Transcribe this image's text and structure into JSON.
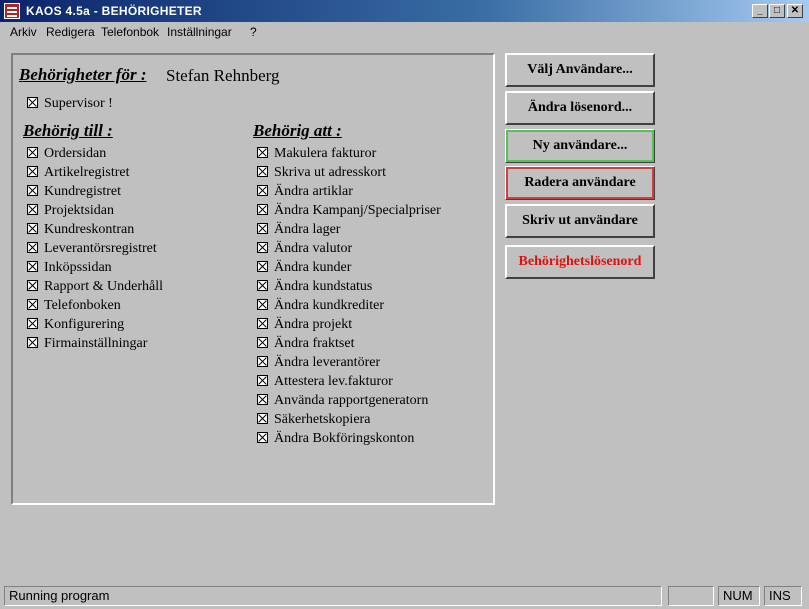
{
  "window": {
    "title": "KAOS 4.5a - BEHÖRIGHETER",
    "controls": {
      "minimize": "_",
      "restore": "□",
      "close": "✕"
    }
  },
  "menu": [
    {
      "label": "Arkiv"
    },
    {
      "label": "Redigera"
    },
    {
      "label": "Telefonbok"
    },
    {
      "label": "Inställningar"
    },
    {
      "label": "?"
    }
  ],
  "panel": {
    "header_label": "Behörigheter för :",
    "user_name": "Stefan Rehnberg",
    "supervisor": {
      "label": "Supervisor !",
      "checked": true
    },
    "behorig_till": {
      "heading": "Behörig till :",
      "items": [
        {
          "label": "Ordersidan",
          "checked": true
        },
        {
          "label": "Artikelregistret",
          "checked": true
        },
        {
          "label": "Kundregistret",
          "checked": true
        },
        {
          "label": "Projektsidan",
          "checked": true
        },
        {
          "label": "Kundreskontran",
          "checked": true
        },
        {
          "label": "Leverantörsregistret",
          "checked": true
        },
        {
          "label": "Inköpssidan",
          "checked": true
        },
        {
          "label": "Rapport & Underhåll",
          "checked": true
        },
        {
          "label": "Telefonboken",
          "checked": true
        },
        {
          "label": "Konfigurering",
          "checked": true
        },
        {
          "label": "Firmainställningar",
          "checked": true
        }
      ]
    },
    "behorig_att": {
      "heading": "Behörig att :",
      "items": [
        {
          "label": "Makulera fakturor",
          "checked": true
        },
        {
          "label": "Skriva ut adresskort",
          "checked": true
        },
        {
          "label": "Ändra artiklar",
          "checked": true
        },
        {
          "label": "Ändra Kampanj/Specialpriser",
          "checked": true
        },
        {
          "label": "Ändra lager",
          "checked": true
        },
        {
          "label": "Ändra valutor",
          "checked": true
        },
        {
          "label": "Ändra kunder",
          "checked": true
        },
        {
          "label": "Ändra kundstatus",
          "checked": true
        },
        {
          "label": "Ändra kundkrediter",
          "checked": true
        },
        {
          "label": "Ändra projekt",
          "checked": true
        },
        {
          "label": "Ändra fraktset",
          "checked": true
        },
        {
          "label": "Ändra leverantörer",
          "checked": true
        },
        {
          "label": "Attestera lev.fakturor",
          "checked": true
        },
        {
          "label": "Använda rapportgeneratorn",
          "checked": true
        },
        {
          "label": "Säkerhetskopiera",
          "checked": true
        },
        {
          "label": "Ändra Bokföringskonton",
          "checked": true
        }
      ]
    }
  },
  "buttons": {
    "valj": "Välj Användare...",
    "andra_losenord": "Ändra lösenord...",
    "ny": "Ny användare...",
    "radera": "Radera användare",
    "skriv_ut": "Skriv ut användare",
    "behorighetslosenord": "Behörighetslösenord"
  },
  "status": {
    "text": "Running program",
    "num": "NUM",
    "ins": "INS"
  }
}
